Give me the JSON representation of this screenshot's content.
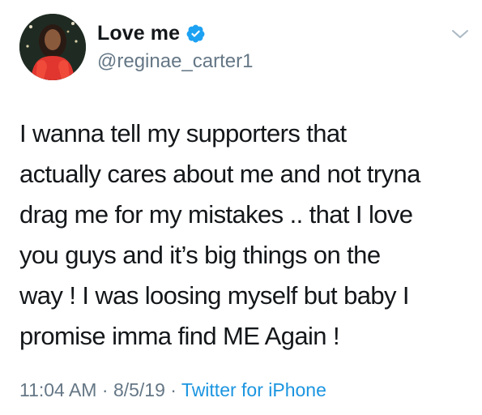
{
  "tweet": {
    "display_name": "Love me",
    "handle": "@reginae_carter1",
    "verified_icon": "verified-badge-icon",
    "text": "I wanna tell my supporters that\nactually cares about me and not tryna\ndrag me for my mistakes .. that I love\nyou guys and it’s big things on the\nway ! I was loosing myself but baby I\npromise imma find ME Again !",
    "time": "11:04 AM",
    "separator": " · ",
    "date": "8/5/19",
    "source": "Twitter for iPhone"
  },
  "colors": {
    "text": "#14171a",
    "secondary": "#657786",
    "link": "#1b95e0",
    "verified": "#1da1f2"
  }
}
